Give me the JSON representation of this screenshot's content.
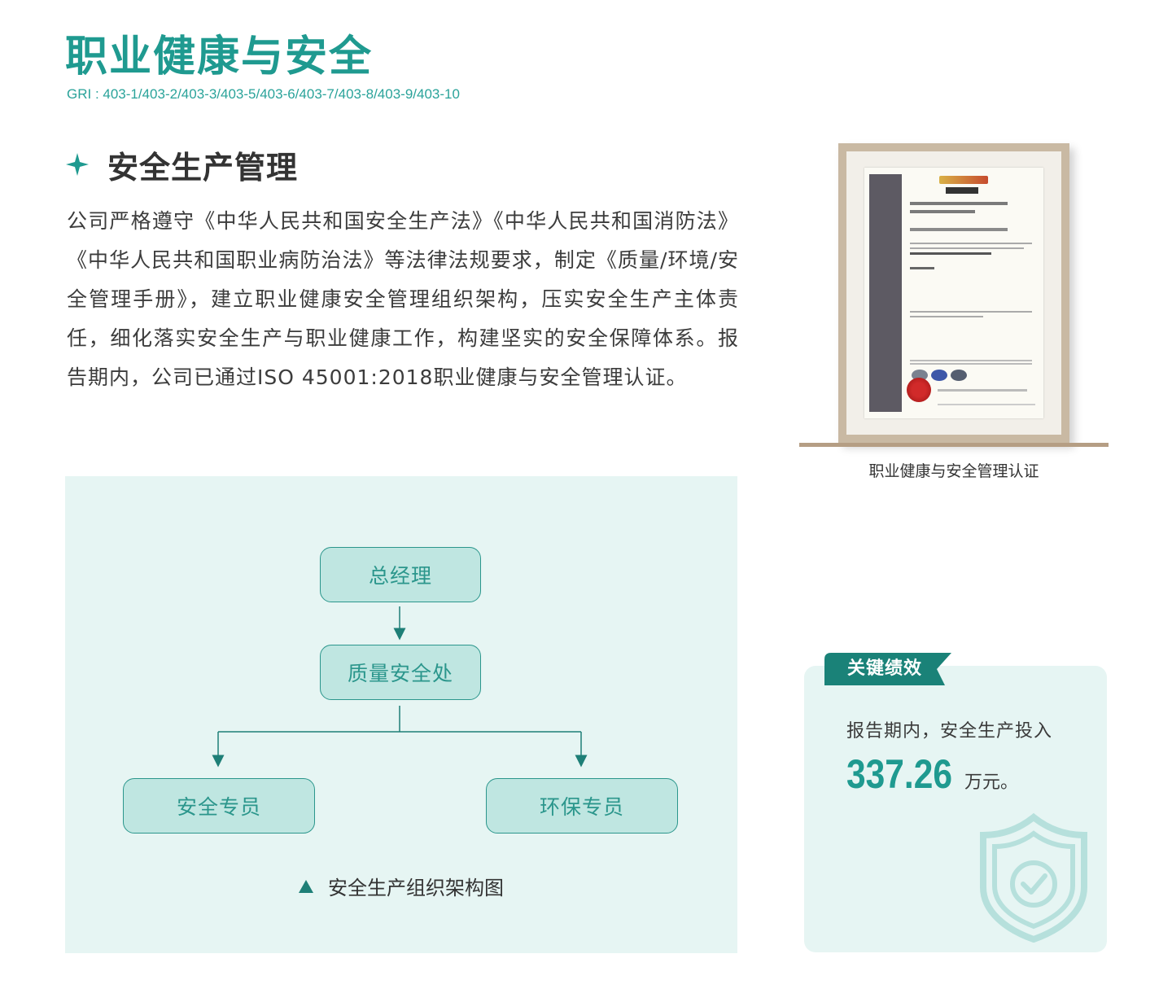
{
  "header": {
    "title": "职业健康与安全",
    "gri": "GRI : 403-1/403-2/403-3/403-5/403-6/403-7/403-8/403-9/403-10"
  },
  "section": {
    "heading": "安全生产管理",
    "paragraph": "公司严格遵守《中华人民共和国安全生产法》《中华人民共和国消防法》《中华人民共和国职业病防治法》等法律法规要求，制定《质量/环境/安全管理手册》，建立职业健康安全管理组织架构，压实安全生产主体责任，细化落实安全生产与职业健康工作，构建坚实的安全保障体系。报告期内，公司已通过ISO 45001:2018职业健康与安全管理认证。"
  },
  "certificate": {
    "caption": "职业健康与安全管理认证"
  },
  "org_chart": {
    "nodes": {
      "top": "总经理",
      "middle": "质量安全处",
      "left": "安全专员",
      "right": "环保专员"
    },
    "caption": "安全生产组织架构图"
  },
  "kpi": {
    "tag": "关键绩效",
    "description": "报告期内，安全生产投入",
    "value": "337.26",
    "unit": "万元。"
  },
  "colors": {
    "accent": "#1f9a90",
    "panel_bg": "#e6f5f3",
    "node_fill": "#bfe6e1",
    "node_border": "#2b968c"
  }
}
